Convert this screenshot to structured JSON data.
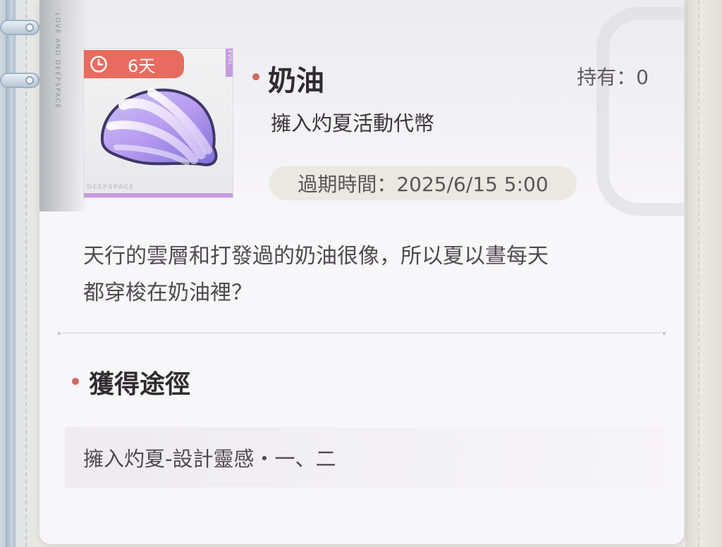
{
  "backdrop": {
    "brand_vertical": "LOVE AND DEEPSPACE"
  },
  "item": {
    "name": "奶油",
    "type": "擁入灼夏活動代幣",
    "owned": "持有：0",
    "expiry": "過期時間：2025/6/15 5:00",
    "timer": "6天",
    "thumb_brand": "DEEPSPACE",
    "thumb_tag": "EVOL",
    "description_lines": [
      "天行的雲層和打發過的奶油很像，所以夏以晝每天",
      "都穿梭在奶油裡？"
    ]
  },
  "source": {
    "title": "獲得途徑",
    "entries": [
      "擁入灼夏-設計靈感・一、二"
    ]
  },
  "colors": {
    "accent_red": "#e86b5f",
    "bullet_red": "#d2685e",
    "rarity_purple": "#c79ae0",
    "card_bg": "#f7f6f8"
  },
  "icons": {
    "timer": "clock-icon",
    "item": "shell-icon"
  }
}
